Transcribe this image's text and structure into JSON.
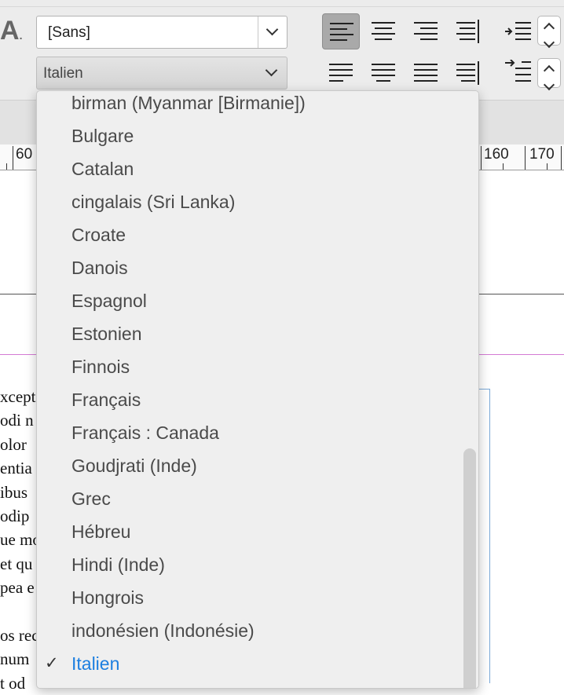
{
  "toolbar": {
    "char_icon": "A",
    "paragraph_style": "[Sans]",
    "language": "Italien",
    "colors": {
      "active_button": "#a9a9a9",
      "selection_blue": "#1d7fe0",
      "margin_magenta": "#d47ad4"
    },
    "align_icons": [
      "align-left-icon",
      "align-center-icon",
      "align-right-icon",
      "align-towards-spine-icon",
      "justify-left-icon",
      "justify-center-icon",
      "justify-all-icon",
      "justify-spine-icon"
    ]
  },
  "ruler": {
    "labels": [
      "60",
      "160",
      "170"
    ]
  },
  "body_text": [
    "xcept",
    "odi n",
    "olor",
    "entia",
    "ibus",
    "odip",
    "ue mo",
    "et qu",
    "pea e",
    "",
    "os rec",
    "num",
    "t od"
  ],
  "dropdown": {
    "items": [
      {
        "label": "birman (Myanmar [Birmanie])",
        "selected": false
      },
      {
        "label": "Bulgare",
        "selected": false
      },
      {
        "label": "Catalan",
        "selected": false
      },
      {
        "label": "cingalais (Sri Lanka)",
        "selected": false
      },
      {
        "label": "Croate",
        "selected": false
      },
      {
        "label": "Danois",
        "selected": false
      },
      {
        "label": "Espagnol",
        "selected": false
      },
      {
        "label": "Estonien",
        "selected": false
      },
      {
        "label": "Finnois",
        "selected": false
      },
      {
        "label": "Français",
        "selected": false
      },
      {
        "label": "Français : Canada",
        "selected": false
      },
      {
        "label": "Goudjrati (Inde)",
        "selected": false
      },
      {
        "label": "Grec",
        "selected": false
      },
      {
        "label": "Hébreu",
        "selected": false
      },
      {
        "label": "Hindi (Inde)",
        "selected": false
      },
      {
        "label": "Hongrois",
        "selected": false
      },
      {
        "label": "indonésien (Indonésie)",
        "selected": false
      },
      {
        "label": "Italien",
        "selected": true
      }
    ],
    "check_glyph": "✓"
  }
}
